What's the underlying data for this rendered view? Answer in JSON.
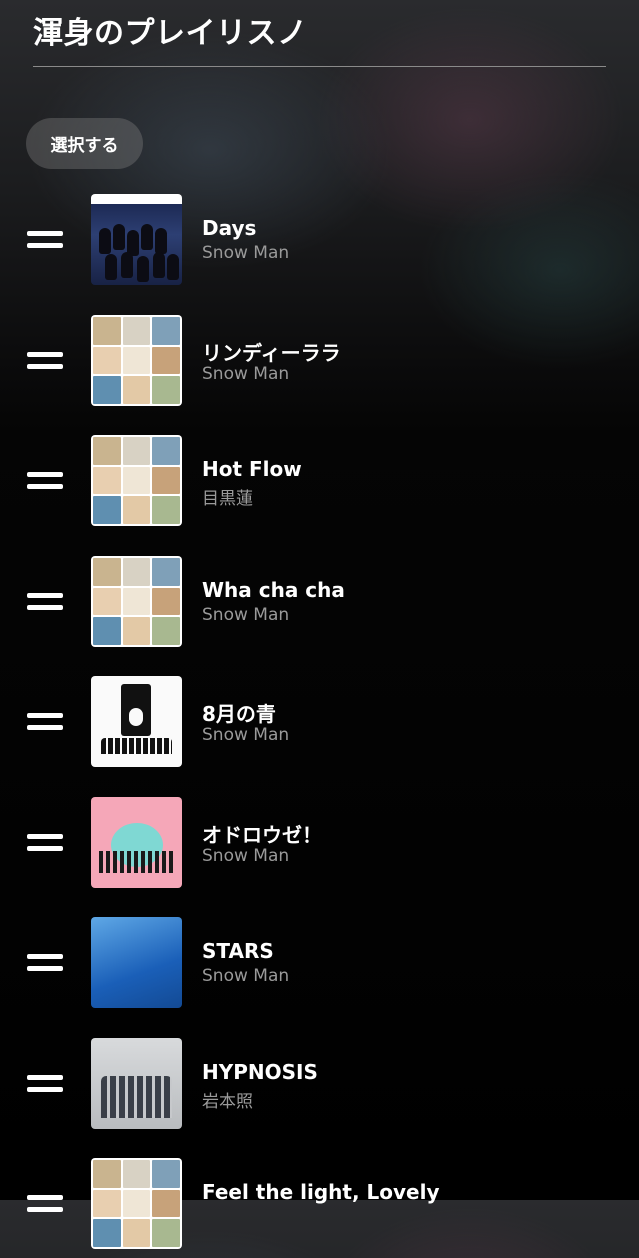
{
  "playlist": {
    "title": "渾身のプレイリスノ"
  },
  "toolbar": {
    "select_label": "選択する"
  },
  "tracks": [
    {
      "title": "Days",
      "artist": "Snow Man",
      "art": "days"
    },
    {
      "title": "リンディーララ",
      "artist": "Snow Man",
      "art": "mosaic"
    },
    {
      "title": "Hot Flow",
      "artist": "目黒蓮",
      "art": "mosaic"
    },
    {
      "title": "Wha cha cha",
      "artist": "Snow Man",
      "art": "mosaic"
    },
    {
      "title": "8月の青",
      "artist": "Snow Man",
      "art": "w8"
    },
    {
      "title": "オドロウゼ！",
      "artist": "Snow Man",
      "art": "odo"
    },
    {
      "title": "STARS",
      "artist": "Snow Man",
      "art": "stars"
    },
    {
      "title": "HYPNOSIS",
      "artist": "岩本照",
      "art": "hyp"
    },
    {
      "title": "Feel the light, Lovely",
      "artist": "",
      "art": "mosaic"
    }
  ],
  "icons": {
    "drag_handle": "drag-handle-icon"
  }
}
